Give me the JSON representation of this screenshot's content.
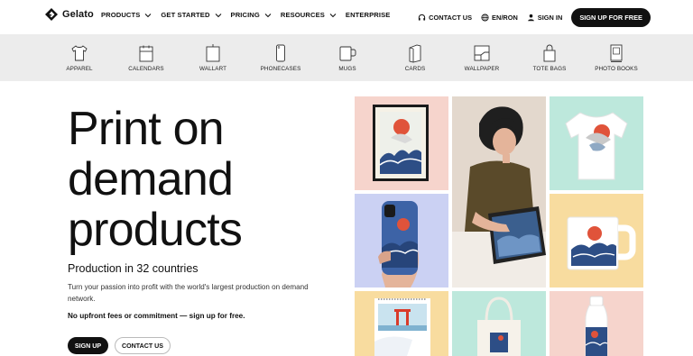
{
  "brand": {
    "name": "Gelato"
  },
  "nav": {
    "menu": [
      "PRODUCTS",
      "GET STARTED",
      "PRICING",
      "RESOURCES",
      "ENTERPRISE"
    ],
    "contact": "CONTACT US",
    "language": "EN/RON",
    "signin": "SIGN IN",
    "signup": "SIGN UP FOR FREE"
  },
  "categories": [
    {
      "label": "APPAREL",
      "icon": "tshirt-icon"
    },
    {
      "label": "CALENDARS",
      "icon": "calendar-icon"
    },
    {
      "label": "WALLART",
      "icon": "frame-icon"
    },
    {
      "label": "PHONECASES",
      "icon": "phone-icon"
    },
    {
      "label": "MUGS",
      "icon": "mug-icon"
    },
    {
      "label": "CARDS",
      "icon": "card-icon"
    },
    {
      "label": "WALLPAPER",
      "icon": "wallpaper-icon"
    },
    {
      "label": "TOTE BAGS",
      "icon": "tote-bag-icon"
    },
    {
      "label": "PHOTO BOOKS",
      "icon": "photo-book-icon"
    }
  ],
  "hero": {
    "title_lines": [
      "Print on",
      "demand",
      "products"
    ],
    "subtitle": "Production in 32 countries",
    "description": "Turn your passion into profit with the world's largest production on demand network.",
    "note": "No upfront fees or commitment — sign up for free.",
    "signup": "SIGN UP",
    "contact": "CONTACT US"
  },
  "colors": {
    "pink": "#f6d4cc",
    "lavender": "#cbd1f3",
    "mint": "#bde8dc",
    "yellow": "#f8dc9f",
    "catbar": "#ececec"
  }
}
